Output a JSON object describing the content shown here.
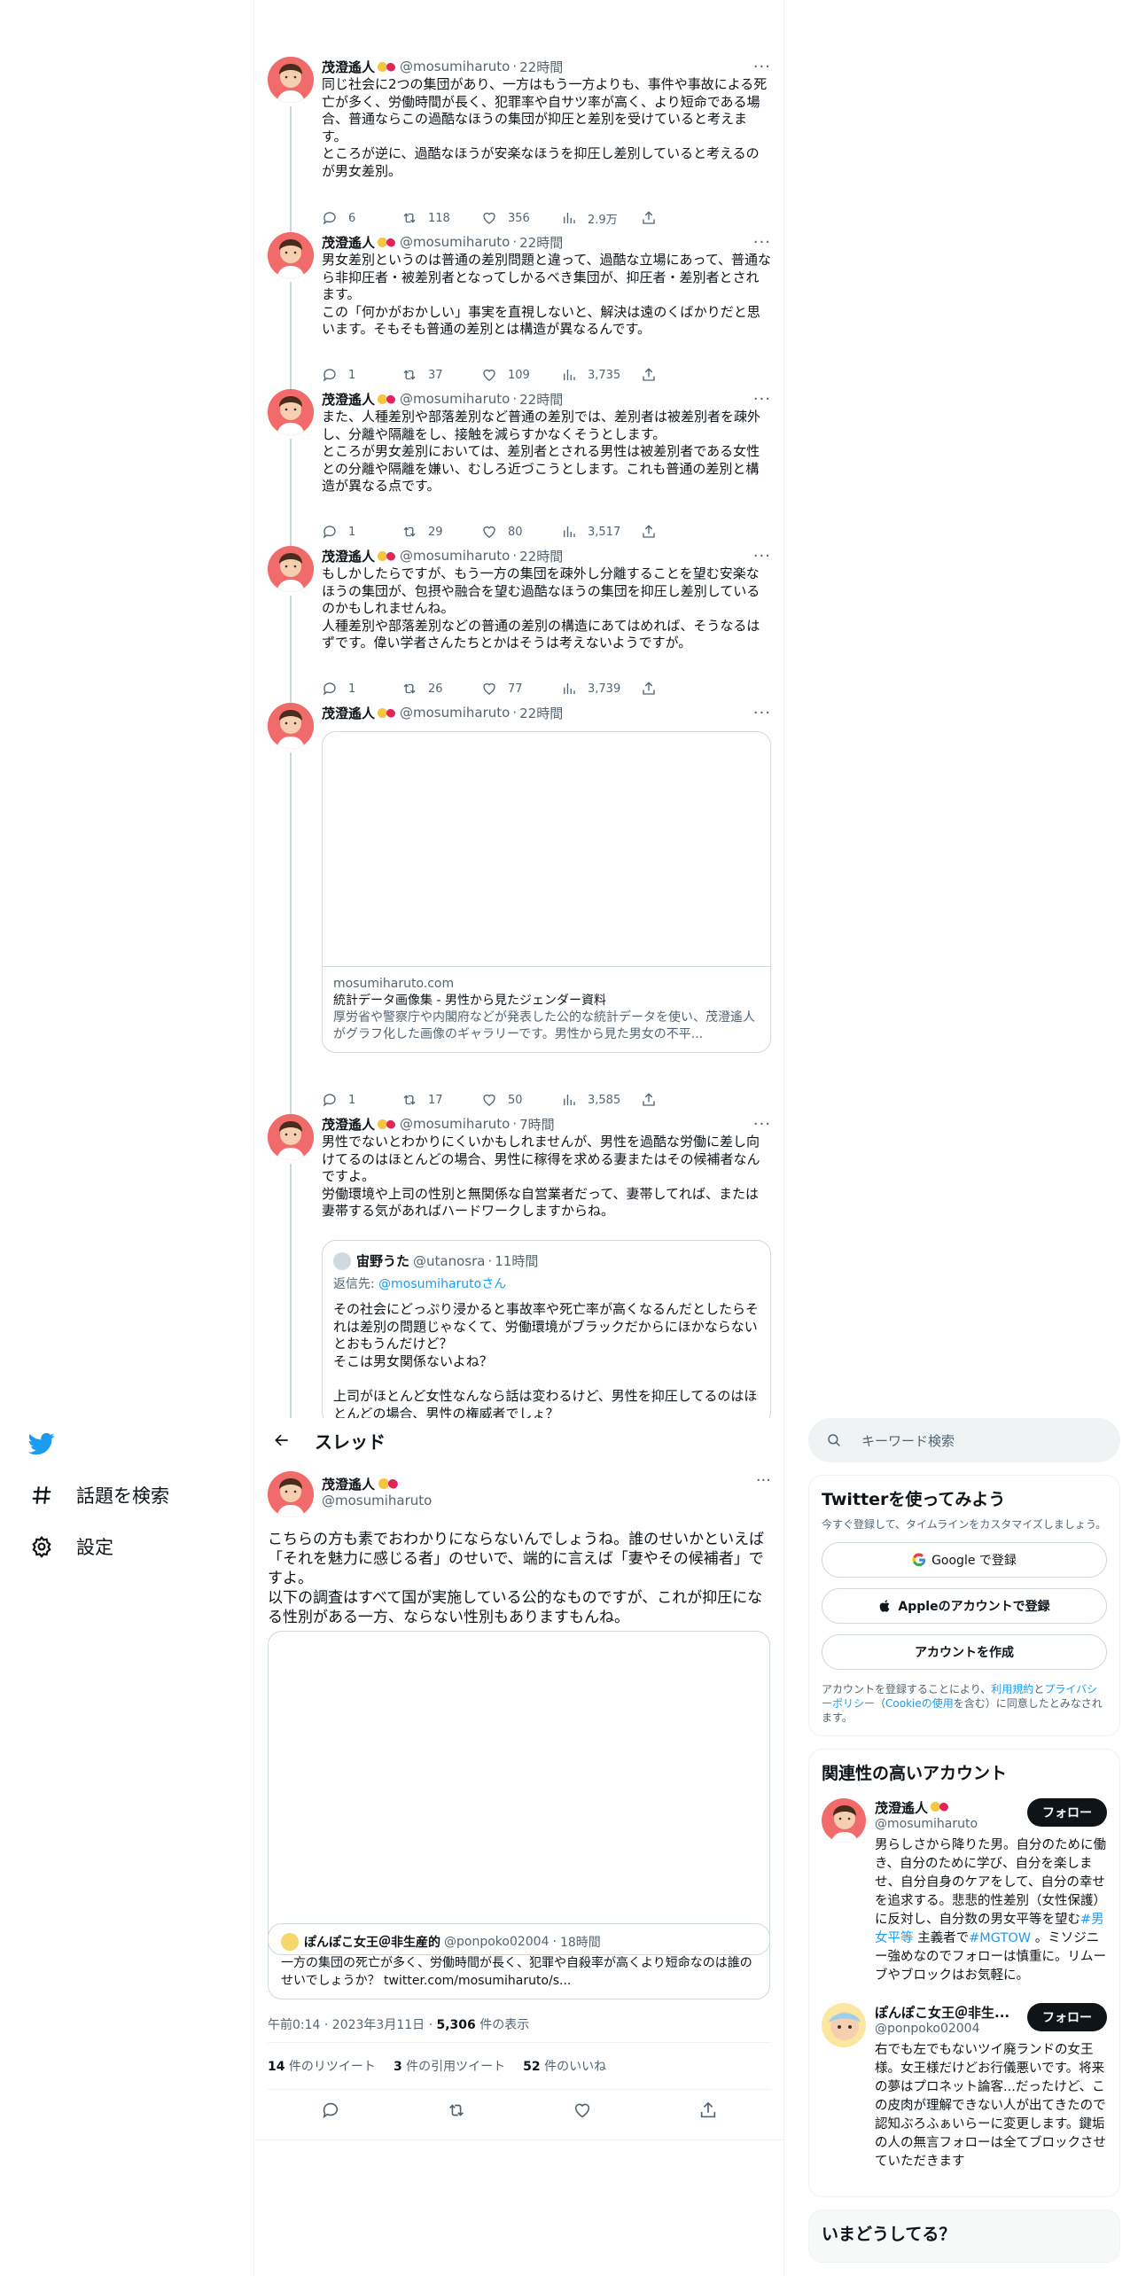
{
  "user": {
    "name": "茂澄遙人",
    "handle": "@mosumiharuto"
  },
  "thread_tweets": [
    {
      "time": "22時間",
      "text": "同じ社会に2つの集団があり、一方はもう一方よりも、事件や事故による死亡が多く、労働時間が長く、犯罪率や自サツ率が高く、より短命である場合、普通ならこの過酷なほうの集団が抑圧と差別を受けていると考えます。\nところが逆に、過酷なほうが安楽なほうを抑圧し差別していると考えるのが男女差別。",
      "reply": "6",
      "retweet": "118",
      "like": "356",
      "views": "2.9万"
    },
    {
      "time": "22時間",
      "text": "男女差別というのは普通の差別問題と違って、過酷な立場にあって、普通なら非抑圧者・被差別者となってしかるべき集団が、抑圧者・差別者とされます。\nこの「何かがおかしい」事実を直視しないと、解決は遠のくばかりだと思います。そもそも普通の差別とは構造が異なるんです。",
      "reply": "1",
      "retweet": "37",
      "like": "109",
      "views": "3,735"
    },
    {
      "time": "22時間",
      "text": "また、人種差別や部落差別など普通の差別では、差別者は被差別者を疎外し、分離や隔離をし、接触を減らすかなくそうとします。\nところが男女差別においては、差別者とされる男性は被差別者である女性との分離や隔離を嫌い、むしろ近づこうとします。これも普通の差別と構造が異なる点です。",
      "reply": "1",
      "retweet": "29",
      "like": "80",
      "views": "3,517"
    },
    {
      "time": "22時間",
      "text": "もしかしたらですが、もう一方の集団を疎外し分離することを望む安楽なほうの集団が、包摂や融合を望む過酷なほうの集団を抑圧し差別しているのかもしれませんね。\n人種差別や部落差別などの普通の差別の構造にあてはめれば、そうなるはずです。偉い学者さんたちとかはそうは考えないようですが。",
      "reply": "1",
      "retweet": "26",
      "like": "77",
      "views": "3,739"
    },
    {
      "time": "22時間",
      "text": "",
      "reply": "1",
      "retweet": "17",
      "like": "50",
      "views": "3,585",
      "card": {
        "domain": "mosumiharuto.com",
        "title": "統計データ画像集 - 男性から見たジェンダー資料",
        "desc": "厚労省や警察庁や内閣府などが発表した公的な統計データを使い、茂澄遙人がグラフ化した画像のギャラリーです。男性から見た男女の不平..."
      }
    },
    {
      "time": "7時間",
      "text": "男性でないとわかりにくいかもしれませんが、男性を過酷な労働に差し向けてるのはほとんどの場合、男性に稼得を求める妻またはその候補者なんですよ。\n労働環境や上司の性別と無関係な自営業者だって、妻帯してれば、または妻帯する気があればハードワークしますからね。",
      "quote": {
        "name": "宙野うた",
        "handle": "@utanosra",
        "time": "11時間",
        "reply_to_label": "返信先:",
        "reply_to": "@mosumiharutoさん",
        "text": "その社会にどっぷり浸かると事故率や死亡率が高くなるんだとしたらそれは差別の問題じゃなくて、労働環境がブラックだからにほかならないとおもうんだけど？\nそこは男女関係ないよね？\n\n上司がほとんど女性なんなら話は変わるけど、男性を抑圧してるのはほとんどの場合、男性の権威者でしょ？"
      }
    }
  ],
  "nav": {
    "explore": "話題を検索",
    "settings": "設定"
  },
  "header": {
    "title": "スレッド"
  },
  "main_tweet": {
    "text": "こちらの方も素でおわかりにならないんでしょうね。誰のせいかといえば「それを魅力に感じる者」のせいで、端的に言えば「妻やその候補者」ですよ。\n以下の調査はすべて国が実施している公的なものですが、これが抑圧になる性別がある一方、ならない性別もありますもんね。",
    "quote": {
      "name": "ぽんぽこ女王＠非生産的",
      "handle": "@ponpoko02004",
      "time": "18時間",
      "text": "一方の集団の死亡が多く、労働時間が長く、犯罪や自殺率が高くより短命なのは誰のせいでしょうか？ twitter.com/mosumiharuto/s..."
    },
    "timestamp": "午前0:14 · 2023年3月11日 · ",
    "views_count": "5,306",
    "views_label": " 件の表示",
    "stats": [
      {
        "n": "14",
        "l": " 件のリツイート"
      },
      {
        "n": "3",
        "l": " 件の引用ツイート"
      },
      {
        "n": "52",
        "l": " 件のいいね"
      }
    ]
  },
  "sidebar": {
    "search_placeholder": "キーワード検索",
    "signup_title": "Twitterを使ってみよう",
    "signup_sub": "今すぐ登録して、タイムラインをカスタマイズしましょう。",
    "google_btn": "Google で登録",
    "apple_btn": "Appleのアカウントで登録",
    "create_btn": "アカウントを作成",
    "legal_1": "アカウントを登録することにより、",
    "legal_link1": "利用規約",
    "legal_2": "と",
    "legal_link2": "プライバシーポリシー",
    "legal_3": "（",
    "legal_link3": "Cookieの使用",
    "legal_4": "を含む）に同意したとみなされます。",
    "related_title": "関連性の高いアカウント",
    "follow_label": "フォロー",
    "accounts": [
      {
        "name": "茂澄遙人",
        "handle": "@mosumiharuto",
        "bio_a": "男らしさから降りた男。自分のために働き、自分のために学び、自分を楽しませ、自分自身のケアをして、自分の幸せを追求する。悲悲的性差別（女性保護）に反対し、自分数の男女平等を望む",
        "tag1": "#男女平等",
        "bio_b": " 主義者で",
        "tag2": "#MGTOW",
        "bio_c": " 。ミソジニー強めなのでフォローは慎重に。リムーブやブロックはお気軽に。"
      },
      {
        "name": "ぽんぽこ女王＠非生...",
        "handle": "@ponpoko02004",
        "bio_a": "右でも左でもないツイ廃ランドの女王様。女王様だけどお行儀悪いです。将来の夢はプロネット論客...だったけど、この皮肉が理解できない人が出てきたので認知ぶろふぁいらーに変更します。鍵垢の人の無言フォローは全てブロックさせていただきます",
        "tag1": "",
        "bio_b": "",
        "tag2": "",
        "bio_c": ""
      }
    ],
    "trends_title": "いまどうしてる？"
  }
}
